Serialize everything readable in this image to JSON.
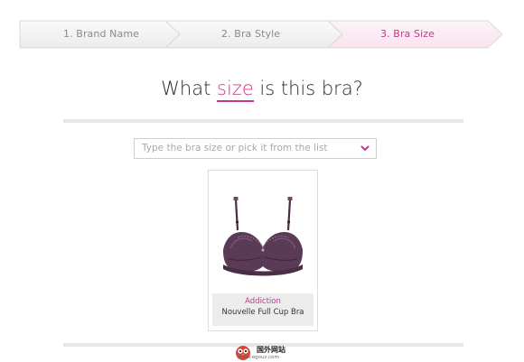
{
  "steps": [
    {
      "label": "1. Brand Name",
      "state": "done"
    },
    {
      "label": "2. Bra Style",
      "state": "done"
    },
    {
      "label": "3. Bra Size",
      "state": "active"
    }
  ],
  "heading": {
    "prefix": "What ",
    "highlight": "size",
    "suffix": " is this bra?"
  },
  "size_select": {
    "placeholder": "Type the bra size or pick it from the list",
    "icon": "chevron-down-icon"
  },
  "product": {
    "brand": "Addiction",
    "name": "Nouvelle Full Cup Bra"
  },
  "watermark": {
    "title": "国外网站",
    "url": "www.egouz.com"
  },
  "colors": {
    "accent": "#c2398a",
    "active_step_bg": "#fbeaf3",
    "step_bg": "#f4f4f4",
    "bra": "#5b3a55"
  }
}
